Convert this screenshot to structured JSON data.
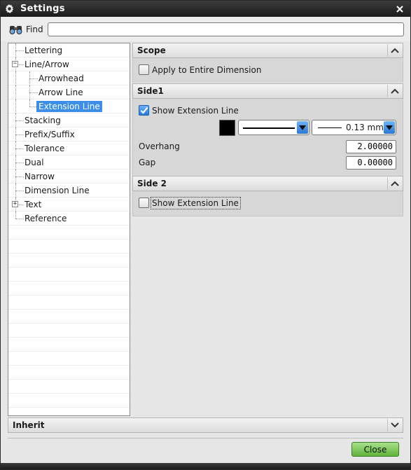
{
  "window": {
    "title": "Settings"
  },
  "find": {
    "label": "Find",
    "value": ""
  },
  "tree": {
    "items": [
      {
        "label": "Lettering",
        "level": 1
      },
      {
        "label": "Line/Arrow",
        "level": 1,
        "expander": "−"
      },
      {
        "label": "Arrowhead",
        "level": 2
      },
      {
        "label": "Arrow Line",
        "level": 2
      },
      {
        "label": "Extension Line",
        "level": 2,
        "selected": true
      },
      {
        "label": "Stacking",
        "level": 1
      },
      {
        "label": "Prefix/Suffix",
        "level": 1
      },
      {
        "label": "Tolerance",
        "level": 1
      },
      {
        "label": "Dual",
        "level": 1
      },
      {
        "label": "Narrow",
        "level": 1
      },
      {
        "label": "Dimension Line",
        "level": 1
      },
      {
        "label": "Text",
        "level": 1,
        "expander": "+"
      },
      {
        "label": "Reference",
        "level": 1
      }
    ]
  },
  "scope": {
    "title": "Scope",
    "apply_label": "Apply to Entire Dimension",
    "apply_checked": false
  },
  "side1": {
    "title": "Side1",
    "show_label": "Show Extension Line",
    "show_checked": true,
    "color": "#000000",
    "line_style": "solid",
    "line_width": "0.13 mm",
    "overhang_label": "Overhang",
    "overhang_value": "2.00000",
    "gap_label": "Gap",
    "gap_value": "0.00000"
  },
  "side2": {
    "title": "Side 2",
    "show_label": "Show Extension Line",
    "show_checked": false
  },
  "inherit": {
    "title": "Inherit"
  },
  "buttons": {
    "close": "Close"
  },
  "colors": {
    "accent": "#3d8ee6",
    "close_button": "#5fb33a",
    "titlebar": "#2a2a2a"
  }
}
